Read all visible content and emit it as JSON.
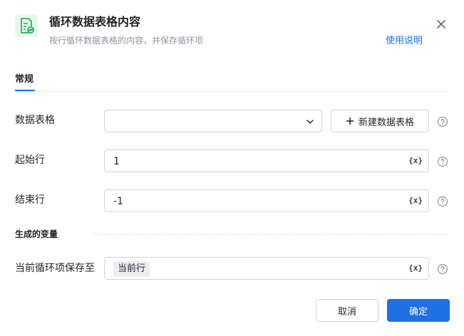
{
  "dialog": {
    "title": "循环数据表格内容",
    "subtitle": "按行循环数据表格的内容，并保存循环项",
    "help_link": "使用说明",
    "icon": "spreadsheet-loop-icon",
    "accent_color": "#1f6fe5",
    "icon_color": "#2db063"
  },
  "tabs": [
    {
      "label": "常规",
      "active": true
    }
  ],
  "fields": {
    "data_table": {
      "label": "数据表格",
      "value": "",
      "new_button": "新建数据表格"
    },
    "start_row": {
      "label": "起始行",
      "value": "1",
      "var_icon": "{x}"
    },
    "end_row": {
      "label": "结束行",
      "value": "-1",
      "var_icon": "{x}"
    }
  },
  "output_section": {
    "title": "生成的变量",
    "save_to": {
      "label": "当前循环项保存至",
      "chip": "当前行",
      "var_icon": "{x}"
    }
  },
  "footer": {
    "cancel": "取消",
    "ok": "确定"
  }
}
